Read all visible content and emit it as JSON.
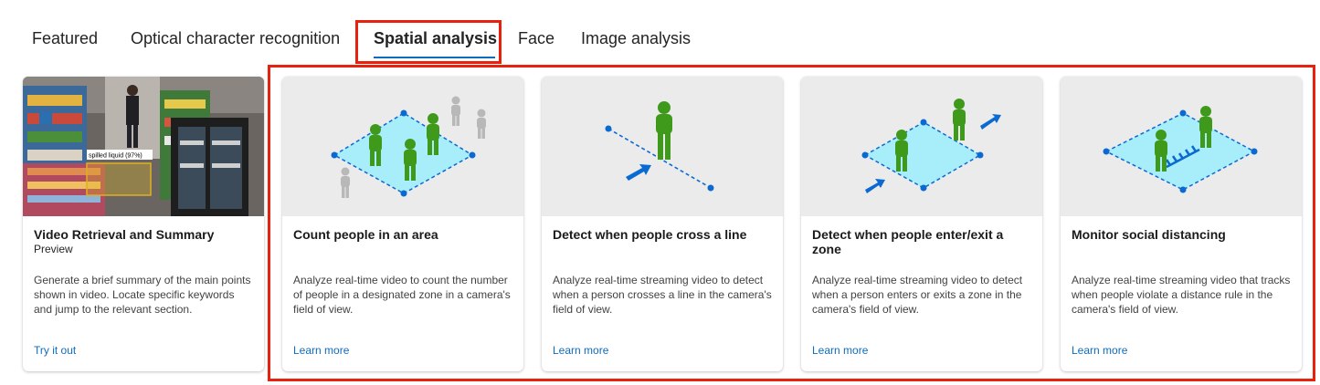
{
  "tabs": [
    {
      "label": "Featured"
    },
    {
      "label": "Optical character recognition"
    },
    {
      "label": "Spatial analysis"
    },
    {
      "label": "Face"
    },
    {
      "label": "Image analysis"
    }
  ],
  "active_tab": "Spatial analysis",
  "cards": [
    {
      "title": "Video Retrieval and Summary",
      "subtitle": "Preview",
      "description": "Generate a brief summary of the main points shown in video. Locate specific keywords and jump to the relevant section.",
      "link": "Try it out",
      "image_caption": "spilled liquid (97%)"
    },
    {
      "title": "Count people in an area",
      "description": "Analyze real-time video to count the number of people in a designated zone in a camera's field of view.",
      "link": "Learn more"
    },
    {
      "title": "Detect when people cross a line",
      "description": "Analyze real-time streaming video to detect when a person crosses a line in the camera's field of view.",
      "link": "Learn more"
    },
    {
      "title": "Detect when people enter/exit a zone",
      "description": "Analyze real-time streaming video to detect when a person enters or exits a zone in the camera's field of view.",
      "link": "Learn more"
    },
    {
      "title": "Monitor social distancing",
      "description": "Analyze real-time streaming video that tracks when people violate a distance rule in the camera's field of view.",
      "link": "Learn more"
    }
  ],
  "colors": {
    "accent": "#0f6cbd",
    "highlight": "#e8210f",
    "zone_fill": "#a8eefa",
    "person_green": "#3f9a1c",
    "arrow_blue": "#0a6ad1"
  }
}
